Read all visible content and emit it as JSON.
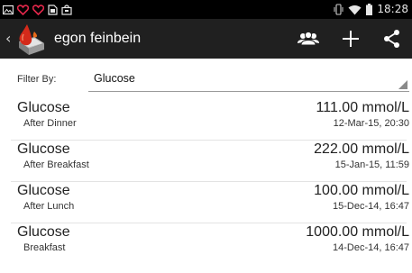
{
  "status_bar": {
    "clock": "18:28",
    "notification_icons": [
      "image-icon",
      "heart-outline-icon",
      "heart-outline-icon",
      "sim-card-icon",
      "bag-icon"
    ],
    "system_icons": [
      "vibrate-icon",
      "wifi-icon",
      "battery-icon"
    ]
  },
  "action_bar": {
    "back_glyph": "‹",
    "app_icon": "glucose-drop-folder-icon",
    "user_name": "egon feinbein",
    "actions": [
      "people-icon",
      "add-icon",
      "share-icon"
    ]
  },
  "filter": {
    "label": "Filter By:",
    "selected": "Glucose"
  },
  "entries": [
    {
      "title": "Glucose",
      "subtitle": "After Dinner",
      "value": "111.00 mmol/L",
      "datetime": "12-Mar-15, 20:30"
    },
    {
      "title": "Glucose",
      "subtitle": "After Breakfast",
      "value": "222.00 mmol/L",
      "datetime": "15-Jan-15, 11:59"
    },
    {
      "title": "Glucose",
      "subtitle": "After Lunch",
      "value": "100.00 mmol/L",
      "datetime": "15-Dec-14, 16:47"
    },
    {
      "title": "Glucose",
      "subtitle": "Breakfast",
      "value": "1000.00 mmol/L",
      "datetime": "14-Dec-14, 16:47"
    }
  ],
  "colors": {
    "status_bar_bg": "#000000",
    "action_bar_bg": "#202020",
    "accent_blood": "#d42a1a",
    "list_bg": "#ffffff",
    "divider": "#e3e3e3"
  }
}
